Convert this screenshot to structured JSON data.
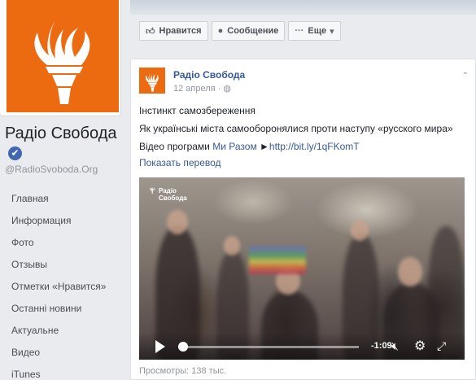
{
  "page": {
    "name": "Радіо Свобода",
    "handle": "@RadioSvoboda.Org",
    "verified_icon": "verified-check-icon",
    "brand_color": "#ec6a10",
    "nav": [
      {
        "label": "Главная"
      },
      {
        "label": "Информация"
      },
      {
        "label": "Фото"
      },
      {
        "label": "Отзывы"
      },
      {
        "label": "Отметки «Нравится»"
      },
      {
        "label": "Останні новини"
      },
      {
        "label": "Актуальне"
      },
      {
        "label": "Видео"
      },
      {
        "label": "iTunes"
      }
    ]
  },
  "actions": {
    "like": "Нравится",
    "message": "Сообщение",
    "more": "Еще"
  },
  "post": {
    "author": "Радіо Свобода",
    "date": "12 апреля",
    "line1": "Інстинкт самозбереження",
    "line2": "Як українські міста самооборонялися проти наступу «русского мира»",
    "line3_prefix": "Відео програми ",
    "line3_link": "Ми Разом",
    "line3_arrow": " ►",
    "line3_url": "http://bit.ly/1qFKomT",
    "translate": "Показать перевод",
    "video": {
      "logo_text_1": "Радіо",
      "logo_text_2": "Свобода",
      "time": "-1:09",
      "progress": 0.02
    },
    "views": "Просмотры: 138 тыс."
  }
}
